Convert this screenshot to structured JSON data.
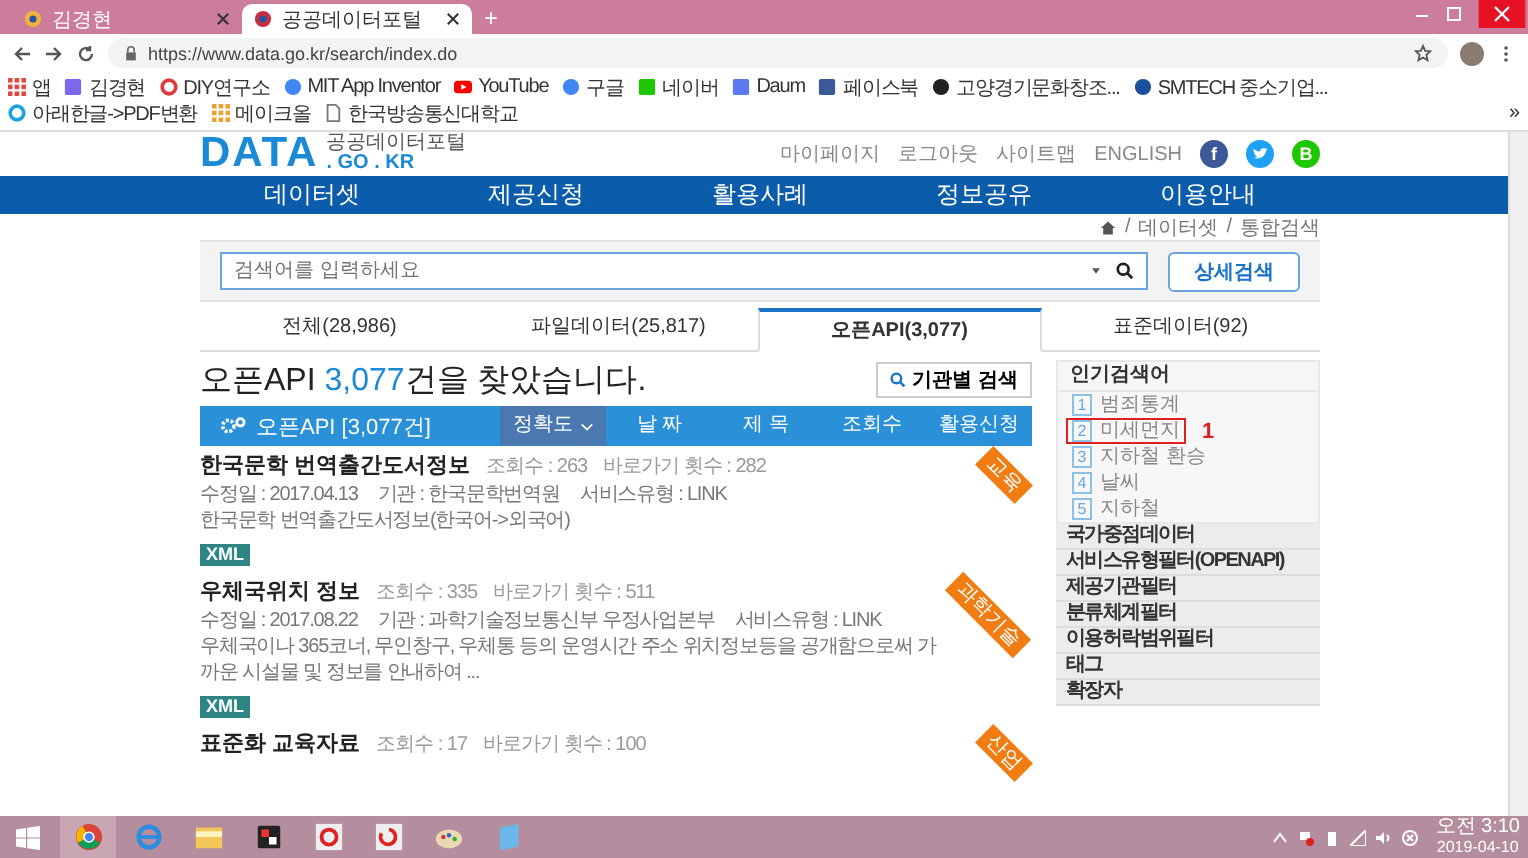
{
  "browser": {
    "tabs": [
      {
        "title": "김경현",
        "selected": false
      },
      {
        "title": "공공데이터포털",
        "selected": true
      }
    ],
    "new_tab": "+",
    "url": "https://www.data.go.kr/search/index.do",
    "bookmarks": [
      {
        "label": "앱",
        "kind": "grid",
        "color": "#e8453c"
      },
      {
        "label": "김경현",
        "kind": "square",
        "color": "#7b68ee"
      },
      {
        "label": "DIY연구소",
        "kind": "ring",
        "color": "#e03a3a"
      },
      {
        "label": "MIT App Inventor",
        "kind": "dot",
        "color": "#4285f4"
      },
      {
        "label": "YouTube",
        "kind": "play",
        "color": "#ff0000"
      },
      {
        "label": "구글",
        "kind": "dot",
        "color": "#4285f4"
      },
      {
        "label": "네이버",
        "kind": "square",
        "color": "#1ec800"
      },
      {
        "label": "Daum",
        "kind": "square",
        "color": "#5a7bf0"
      },
      {
        "label": "페이스북",
        "kind": "square",
        "color": "#3b5998"
      },
      {
        "label": "고양경기문화창조...",
        "kind": "dot",
        "color": "#222222"
      },
      {
        "label": "SMTECH 중소기업...",
        "kind": "dot",
        "color": "#1a4f9c"
      },
      {
        "label": "아래한글->PDF변환",
        "kind": "ring",
        "color": "#1aa3e0"
      },
      {
        "label": "메이크올",
        "kind": "grid",
        "color": "#f0a030"
      },
      {
        "label": "한국방송통신대학교",
        "kind": "page",
        "color": "#777777"
      }
    ],
    "more": "»"
  },
  "header": {
    "logo": "DATA",
    "logo_sub": "공공데이터포털",
    "logo_domain": ". GO . KR",
    "links": [
      "마이페이지",
      "로그아웃",
      "사이트맵",
      "ENGLISH"
    ],
    "social": [
      {
        "kind": "facebook",
        "glyph": "f",
        "color": "#3b5998"
      },
      {
        "kind": "twitter",
        "color": "#1da1f2"
      },
      {
        "kind": "blog",
        "glyph": "B",
        "color": "#1ec800"
      }
    ]
  },
  "nav": [
    "데이터셋",
    "제공신청",
    "활용사례",
    "정보공유",
    "이용안내"
  ],
  "breadcrumb": {
    "separator": "/",
    "items": [
      "데이터셋",
      "통합검색"
    ]
  },
  "search": {
    "placeholder": "검색어를 입력하세요",
    "button": "상세검색"
  },
  "tabs": [
    {
      "label": "전체(28,986)",
      "selected": false
    },
    {
      "label": "파일데이터(25,817)",
      "selected": false
    },
    {
      "label": "오픈API(3,077)",
      "selected": true
    },
    {
      "label": "표준데이터(92)",
      "selected": false
    }
  ],
  "result_title": {
    "before": "오픈API ",
    "count": "3,077",
    "after": "건을 찾았습니다."
  },
  "org_search_button": "기관별 검색",
  "table_header": {
    "title": "오픈API [3,077건]",
    "sorts": [
      {
        "label": "정확도",
        "selected": true
      },
      {
        "label": "날 짜",
        "selected": false
      },
      {
        "label": "제 목",
        "selected": false
      },
      {
        "label": "조회수",
        "selected": false
      },
      {
        "label": "활용신청",
        "selected": false
      }
    ]
  },
  "results": [
    {
      "title": "한국문학 번역출간도서정보",
      "views": "조회수 : 263",
      "clicks": "바로가기 횟수 : 282",
      "modified": "수정일 : 2017.04.13",
      "org": "기관 : 한국문학번역원",
      "service_type": "서비스유형 : LINK",
      "description": "한국문학 번역출간도서정보(한국어->외국어)",
      "format": "XML",
      "category": "교육"
    },
    {
      "title": "우체국위치 정보",
      "views": "조회수 : 335",
      "clicks": "바로가기 횟수 : 511",
      "modified": "수정일 : 2017.08.22",
      "org": "기관 : 과학기술정보통신부 우정사업본부",
      "service_type": "서비스유형 : LINK",
      "description": "우체국이나 365코너, 무인창구, 우체통 등의 운영시간 주소 위치정보등을 공개함으로써 가까운 시설물 및 정보를 안내하여 ...",
      "format": "XML",
      "category": "과학기술"
    },
    {
      "title": "표준화 교육자료",
      "views": "조회수 : 17",
      "clicks": "바로가기 횟수 : 100",
      "category": "산업"
    }
  ],
  "sidebar": {
    "popular_title": "인기검색어",
    "popular": [
      {
        "rank": "1",
        "term": "범죄통계",
        "highlighted": false
      },
      {
        "rank": "2",
        "term": "미세먼지",
        "highlighted": true
      },
      {
        "rank": "3",
        "term": "지하철 환승",
        "highlighted": false
      },
      {
        "rank": "4",
        "term": "날씨",
        "highlighted": false
      },
      {
        "rank": "5",
        "term": "지하철",
        "highlighted": false
      }
    ],
    "annotation": "1",
    "filters": [
      "국가중점데이터",
      "서비스유형필터(OPENAPI)",
      "제공기관필터",
      "분류체계필터",
      "이용허락범위필터",
      "태그",
      "확장자"
    ]
  },
  "taskbar": {
    "apps": [
      {
        "kind": "chrome",
        "active": true
      },
      {
        "kind": "ie",
        "active": false
      },
      {
        "kind": "folder",
        "active": false
      },
      {
        "kind": "app",
        "active": false
      },
      {
        "kind": "sync",
        "active": false
      },
      {
        "kind": "refresh",
        "active": false
      },
      {
        "kind": "paint",
        "active": false
      },
      {
        "kind": "notepad",
        "active": false
      }
    ],
    "time": "오전 3:10",
    "date": "2019-04-10"
  }
}
